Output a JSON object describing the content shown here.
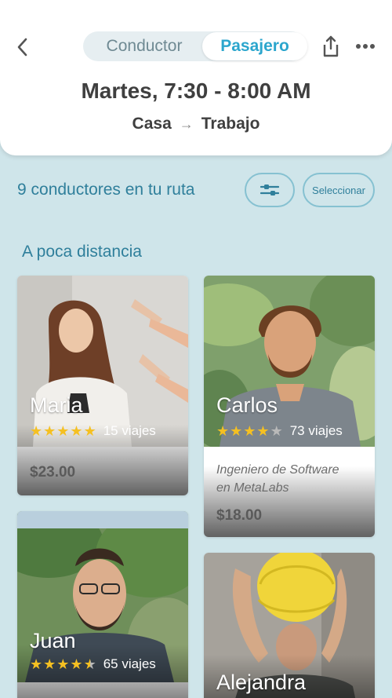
{
  "header": {
    "segments": {
      "driver": "Conductor",
      "passenger": "Pasajero",
      "selected": "Pasajero"
    },
    "title": "Martes, 7:30 - 8:00 AM",
    "route": {
      "from": "Casa",
      "to": "Trabajo"
    }
  },
  "list": {
    "count_text": "9 conductores en tu ruta",
    "select_label": "Seleccionar",
    "section_title": "A poca distancia"
  },
  "drivers": [
    {
      "name": "Maria",
      "rating": 5,
      "trips": "15 viajes",
      "price": "$23.00",
      "job": ""
    },
    {
      "name": "Carlos",
      "rating": 4,
      "trips": "73 viajes",
      "job_line1": "Ingeniero de Software",
      "job_line2": "en MetaLabs",
      "price": "$18.00"
    },
    {
      "name": "Juan",
      "rating": 4.5,
      "trips": "65 viajes"
    },
    {
      "name": "Alejandra"
    }
  ],
  "colors": {
    "accent": "#2ca6cd",
    "background": "#cfe5ea",
    "star": "#f5c022",
    "link": "#2f7f9b"
  },
  "icons": [
    "chevron-left-icon",
    "share-icon",
    "more-icon",
    "filter-icon",
    "star-icon"
  ]
}
